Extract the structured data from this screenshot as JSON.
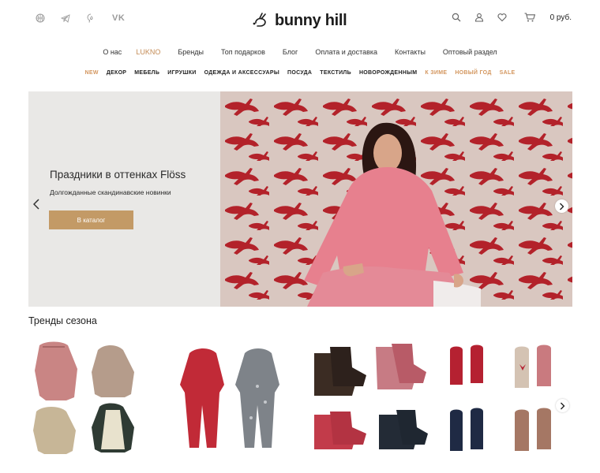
{
  "header": {
    "social": [
      "vk"
    ],
    "social_vk": "VK",
    "logo": "bunny hill",
    "cart_price": "0 руб."
  },
  "menu": [
    {
      "label": "О нас",
      "highlight": false
    },
    {
      "label": "LUKNO",
      "highlight": true
    },
    {
      "label": "Бренды",
      "highlight": false
    },
    {
      "label": "Топ подарков",
      "highlight": false
    },
    {
      "label": "Блог",
      "highlight": false
    },
    {
      "label": "Оплата и доставка",
      "highlight": false
    },
    {
      "label": "Контакты",
      "highlight": false
    },
    {
      "label": "Оптовый раздел",
      "highlight": false
    }
  ],
  "categories": [
    {
      "label": "NEW",
      "orange": true
    },
    {
      "label": "ДЕКОР",
      "orange": false
    },
    {
      "label": "МЕБЕЛЬ",
      "orange": false
    },
    {
      "label": "ИГРУШКИ",
      "orange": false
    },
    {
      "label": "ОДЕЖДА И АКСЕССУАРЫ",
      "orange": false
    },
    {
      "label": "ПОСУДА",
      "orange": false
    },
    {
      "label": "ТЕКСТИЛЬ",
      "orange": false
    },
    {
      "label": "НОВОРОЖДЕННЫМ",
      "orange": false
    },
    {
      "label": "К ЗИМЕ",
      "orange": true
    },
    {
      "label": "НОВЫЙ ГОД",
      "orange": true
    },
    {
      "label": "SALE",
      "orange": true
    }
  ],
  "hero": {
    "title": "Праздники в оттенках Flöss",
    "subtitle": "Долгожданные скандинавские новинки",
    "button": "В каталог"
  },
  "trends": {
    "title": "Тренды сезона"
  },
  "colors": {
    "accent": "#c39a66",
    "orange": "#d3965e",
    "hero_bg": "#e9e8e6"
  }
}
